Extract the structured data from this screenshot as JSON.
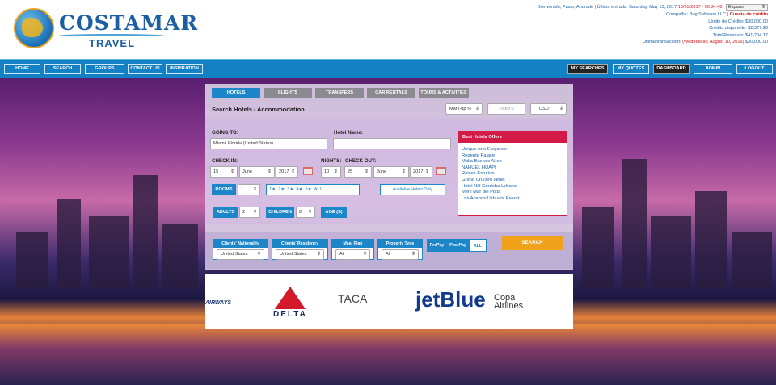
{
  "header": {
    "brand": "COSTAMAR",
    "brand_sub": "TRAVEL",
    "greeting": "Bienvenido, Paulo, Andrade",
    "last_login_label": "| Última entrada: Saturday, May 13, 2017",
    "last_login_red": "13/05/2017 - 06:34:48",
    "language": "Espanol",
    "company_label": "Compañia:",
    "company_value": "Bug Software LLC",
    "credit_account": "Cuenta de crédito",
    "credit_limit": "Límite de Crédito: $30,000.00",
    "credit_available": "Crédito disponible: $2,377.28",
    "total_reservations": "Total Reservas: $41,204.17",
    "last_txn_label": "Ultima transacción:",
    "last_txn_date": "(Wednesday, August 10, 2016)",
    "last_txn_amount": "$30,000.00"
  },
  "nav": {
    "left": [
      "HOME",
      "SEARCH",
      "GROUPS",
      "CONTACT US",
      "INSPIRATION"
    ],
    "right": [
      "MY SEARCHES",
      "MY QUOTES",
      "DASHBOARD",
      "ADMIN",
      "LOGOUT"
    ]
  },
  "tabs": [
    "HOTELS",
    "FLIGHTS",
    "TRANSFERS",
    "CAR RENTALS",
    "TOURS & ACTIVITIES"
  ],
  "panel": {
    "title": "Search Hotels / Accommodation",
    "markup": "Mark-up %",
    "fixed_placeholder": "Fixed 0",
    "currency": "USD"
  },
  "form": {
    "going_to_label": "GOING TO:",
    "going_to_value": "Miami, Florida (United States)",
    "hotel_name_label": "Hotel Name:",
    "checkin_label": "CHECK IN:",
    "checkin_day": "15",
    "checkin_month": "June",
    "checkin_year": "2017",
    "nights_label": "NIGHTS:",
    "nights_value": "10",
    "checkout_label": "CHECK OUT:",
    "checkout_day": "25",
    "checkout_month": "June",
    "checkout_year": "2017",
    "rooms_label": "ROOMS",
    "rooms_value": "1",
    "stars": [
      "1★",
      "2★",
      "3★",
      "4★",
      "5★",
      "ALL"
    ],
    "available_only": "Available Hotels Only",
    "adults_label": "ADULTS",
    "adults_value": "2",
    "children_label": "CHILDREN",
    "children_value": "0",
    "age_label": "AGE (S)"
  },
  "offers": {
    "title": "Best Hotels Offers",
    "items": [
      "Unique Arte Elegance",
      "Regente Palace",
      "Malia Buenos Aires",
      "NAHUEL HUAPI",
      "Raices Esturion",
      "Grand Crucero Hotel",
      "Hotel NH Córdoba Urbano",
      "Meril Mar del Plata",
      "Los Acebos Ushuaia Resort"
    ]
  },
  "filters": {
    "nationality_label": "Clients' Nationality",
    "nationality_value": "United States",
    "residency_label": "Clients' Residency",
    "residency_value": "United States",
    "meal_label": "Meal Plan",
    "meal_value": "All",
    "property_label": "Property Type",
    "property_value": "All",
    "prepay": "PrePay",
    "postpay": "PostPay",
    "all": "ALL",
    "search": "SEARCH"
  },
  "airlines": [
    "AIRWAYS",
    "DELTA",
    "TACA",
    "jetBlue",
    "Copa Airlines"
  ],
  "colors": {
    "nav": "#1481c4",
    "accent": "#1b86c8",
    "offers": "#d41a46",
    "search": "#f0a21a"
  }
}
